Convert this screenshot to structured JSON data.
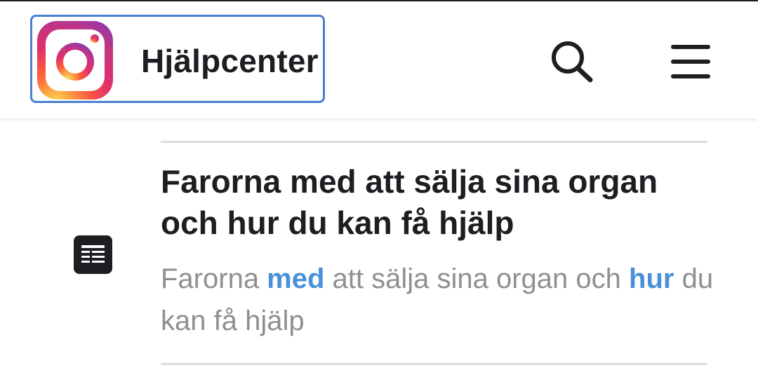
{
  "header": {
    "title": "Hjälpcenter",
    "logo_icon": "instagram-logo-icon",
    "search_icon": "search-icon",
    "menu_icon": "hamburger-menu-icon",
    "focus_outline_color": "#4a7fd3"
  },
  "result": {
    "icon": "article-document-icon",
    "title": "Farorna med att sälja sina organ och hur du kan få hjälp",
    "snippet": {
      "part1": "Farorna ",
      "highlight1": "med",
      "part2": " att sälja sina organ och ",
      "highlight2": "hur",
      "part3": " du kan få hjälp"
    },
    "highlight_color": "#4a90d9"
  }
}
